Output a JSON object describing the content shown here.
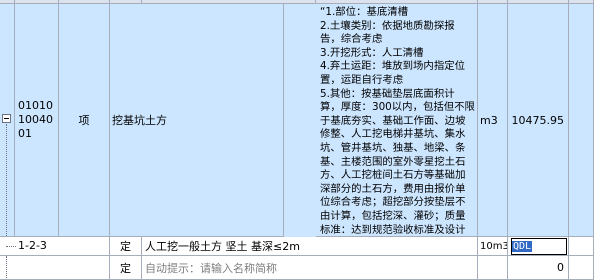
{
  "item": {
    "code": "010101004001",
    "type": "项",
    "name": "挖基坑土方",
    "description": "“1.部位：基底清槽\n2.土壤类别：依据地质勘探报告，综合考虑\n3.开挖形式：人工清槽\n4.弃土运距：堆放到场内指定位置，运距自行考虑\n5.其他：按基础垫层底面积计算，厚度：300以内，包括但不限于基底夯实、基础工作面、边坡修整、人工挖电梯井基坑、集水坑、管井基坑、独基、地梁、条基、主楼范围的室外零星挖土石方、人工挖桩间土石方等基础加深部分的土石方，费用由报价单位综合考虑；超挖部分按垫层不由计算，包括挖深、灌砂；质量标准：达到规范验收标准及设计要求。”",
    "unit": "m3",
    "quantity": "10475.95"
  },
  "sub_rows": [
    {
      "code": "1-2-3",
      "type": "定",
      "name": "人工挖一般土方 坚土 基深≤2m",
      "unit": "10m3",
      "quantity_input": "QDL"
    },
    {
      "type": "定",
      "name_hint": "自动提示：请输入名称简称",
      "quantity": "0"
    }
  ],
  "colors": {
    "selected_row_bg": "#cde6ff",
    "grid_line": "#a7aebb",
    "hint_text": "#7f7f7f",
    "selection_highlight": "#316ac5"
  },
  "icons": {
    "expander": "minus-box-icon"
  }
}
